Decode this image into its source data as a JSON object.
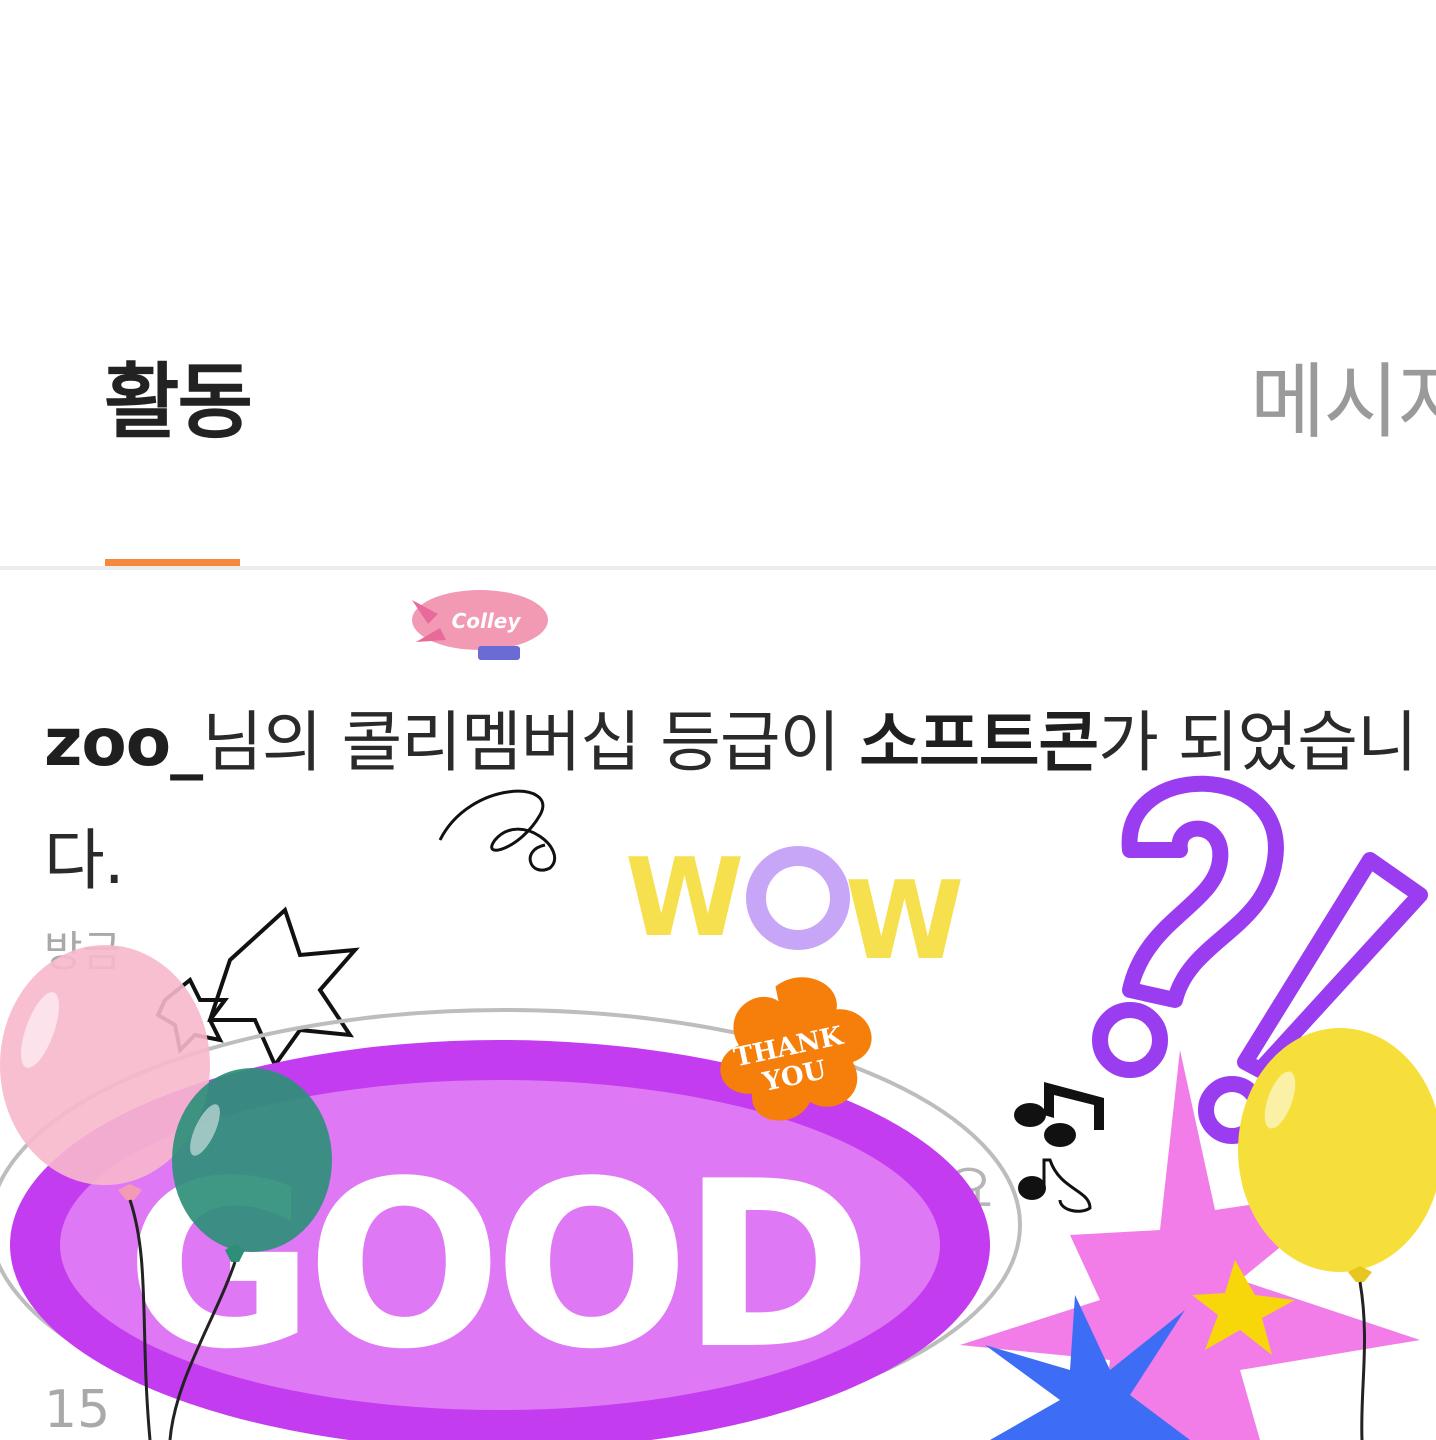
{
  "tabs": {
    "activity": "활동",
    "messages": "메시지"
  },
  "notification": {
    "username": "zoo_",
    "text_1": "님의 콜리멤버십 등급이 ",
    "grade": "소프트콘",
    "text_2": "가 되었습니다.",
    "time": "방금"
  },
  "next_item": {
    "count_partial": "15",
    "text_partial": "요"
  },
  "stickers": {
    "blimp": "Colley",
    "wow": "WOW",
    "thank_you_1": "THANK",
    "thank_you_2": "YOU",
    "good": "GOOD"
  },
  "colors": {
    "accent": "#f5883a",
    "good_purple": "#c43cf0",
    "wow_yellow": "#f7e04d",
    "question_purple": "#9a3cf0"
  }
}
